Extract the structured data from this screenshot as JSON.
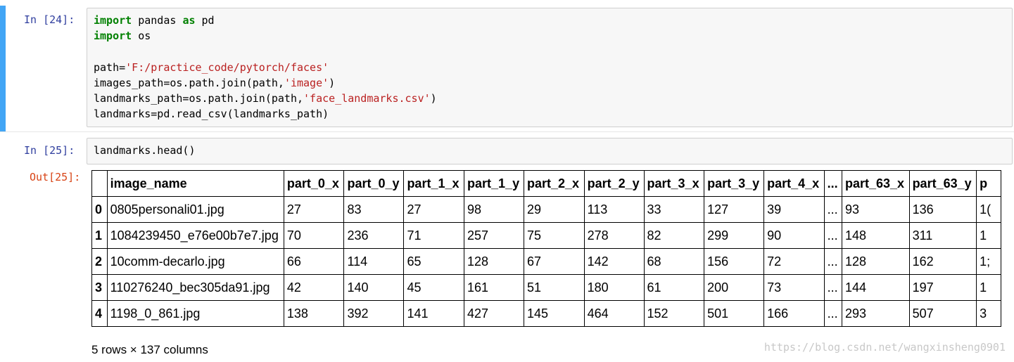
{
  "cell1": {
    "prompt": "In  [24]:",
    "lines": [
      {
        "kw1": "import",
        "rest1": " pandas ",
        "kw2": "as",
        "rest2": " pd"
      },
      {
        "kw1": "import",
        "rest1": " os"
      }
    ],
    "path_prefix": "path=",
    "path_str": "'F:/practice_code/pytorch/faces'",
    "images_prefix": "images_path=os.path.join(path,",
    "images_str": "'image'",
    "images_suffix": ")",
    "landmarks_path_prefix": "landmarks_path=os.path.join(path,",
    "landmarks_path_str": "'face_landmarks.csv'",
    "landmarks_path_suffix": ")",
    "read_line": "landmarks=pd.read_csv(landmarks_path)"
  },
  "cell2": {
    "prompt": "In  [25]:",
    "code": "landmarks.head()",
    "out_prompt": "Out[25]:"
  },
  "table": {
    "columns": [
      "",
      "image_name",
      "part_0_x",
      "part_0_y",
      "part_1_x",
      "part_1_y",
      "part_2_x",
      "part_2_y",
      "part_3_x",
      "part_3_y",
      "part_4_x",
      "...",
      "part_63_x",
      "part_63_y",
      "p"
    ],
    "rows": [
      [
        "0",
        "0805personali01.jpg",
        "27",
        "83",
        "27",
        "98",
        "29",
        "113",
        "33",
        "127",
        "39",
        "...",
        "93",
        "136",
        "1("
      ],
      [
        "1",
        "1084239450_e76e00b7e7.jpg",
        "70",
        "236",
        "71",
        "257",
        "75",
        "278",
        "82",
        "299",
        "90",
        "...",
        "148",
        "311",
        "1"
      ],
      [
        "2",
        "10comm-decarlo.jpg",
        "66",
        "114",
        "65",
        "128",
        "67",
        "142",
        "68",
        "156",
        "72",
        "...",
        "128",
        "162",
        "1;"
      ],
      [
        "3",
        "110276240_bec305da91.jpg",
        "42",
        "140",
        "45",
        "161",
        "51",
        "180",
        "61",
        "200",
        "73",
        "...",
        "144",
        "197",
        "1"
      ],
      [
        "4",
        "1198_0_861.jpg",
        "138",
        "392",
        "141",
        "427",
        "145",
        "464",
        "152",
        "501",
        "166",
        "...",
        "293",
        "507",
        "3"
      ]
    ],
    "summary": "5 rows × 137 columns"
  },
  "watermark": "https://blog.csdn.net/wangxinsheng0901",
  "colors": {
    "selected_cell_bar": "#42a5f5",
    "in_prompt": "#303f9f",
    "out_prompt": "#d84315",
    "keyword": "#008000",
    "string": "#ba2121"
  }
}
